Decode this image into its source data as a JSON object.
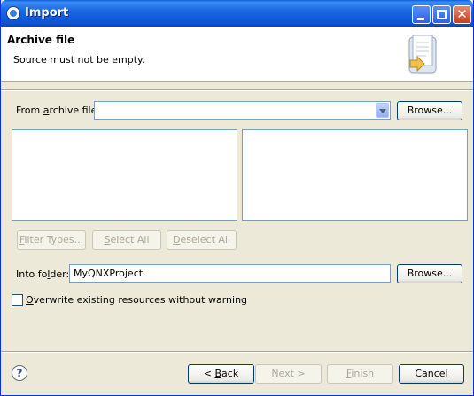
{
  "window": {
    "title": "Import"
  },
  "header": {
    "title": "Archive file",
    "message": "Source must not be empty."
  },
  "archive": {
    "label_pre": "From ",
    "label_mnemonic": "a",
    "label_post": "rchive file:",
    "value": "",
    "browse_label": "Browse..."
  },
  "filter_buttons": {
    "filter_types_pre": "",
    "filter_types_mnemonic": "F",
    "filter_types_post": "ilter Types...",
    "select_all_pre": "",
    "select_all_mnemonic": "S",
    "select_all_post": "elect All",
    "deselect_all_pre": "",
    "deselect_all_mnemonic": "D",
    "deselect_all_post": "eselect All"
  },
  "folder": {
    "label_pre": "Into fo",
    "label_mnemonic": "l",
    "label_post": "der:",
    "value": "MyQNXProject",
    "browse_label": "Browse..."
  },
  "overwrite": {
    "label_pre": "",
    "label_mnemonic": "O",
    "label_post": "verwrite existing resources without warning",
    "checked": false
  },
  "footer": {
    "help_glyph": "?",
    "back_pre": "< ",
    "back_mnemonic": "B",
    "back_post": "ack",
    "next_label": "Next >",
    "finish_pre": "",
    "finish_mnemonic": "F",
    "finish_post": "inish",
    "cancel_label": "Cancel"
  },
  "colors": {
    "titlebar": "#0a54d4",
    "dialog_bg": "#ece9d8",
    "disabled_text": "#aca899"
  }
}
